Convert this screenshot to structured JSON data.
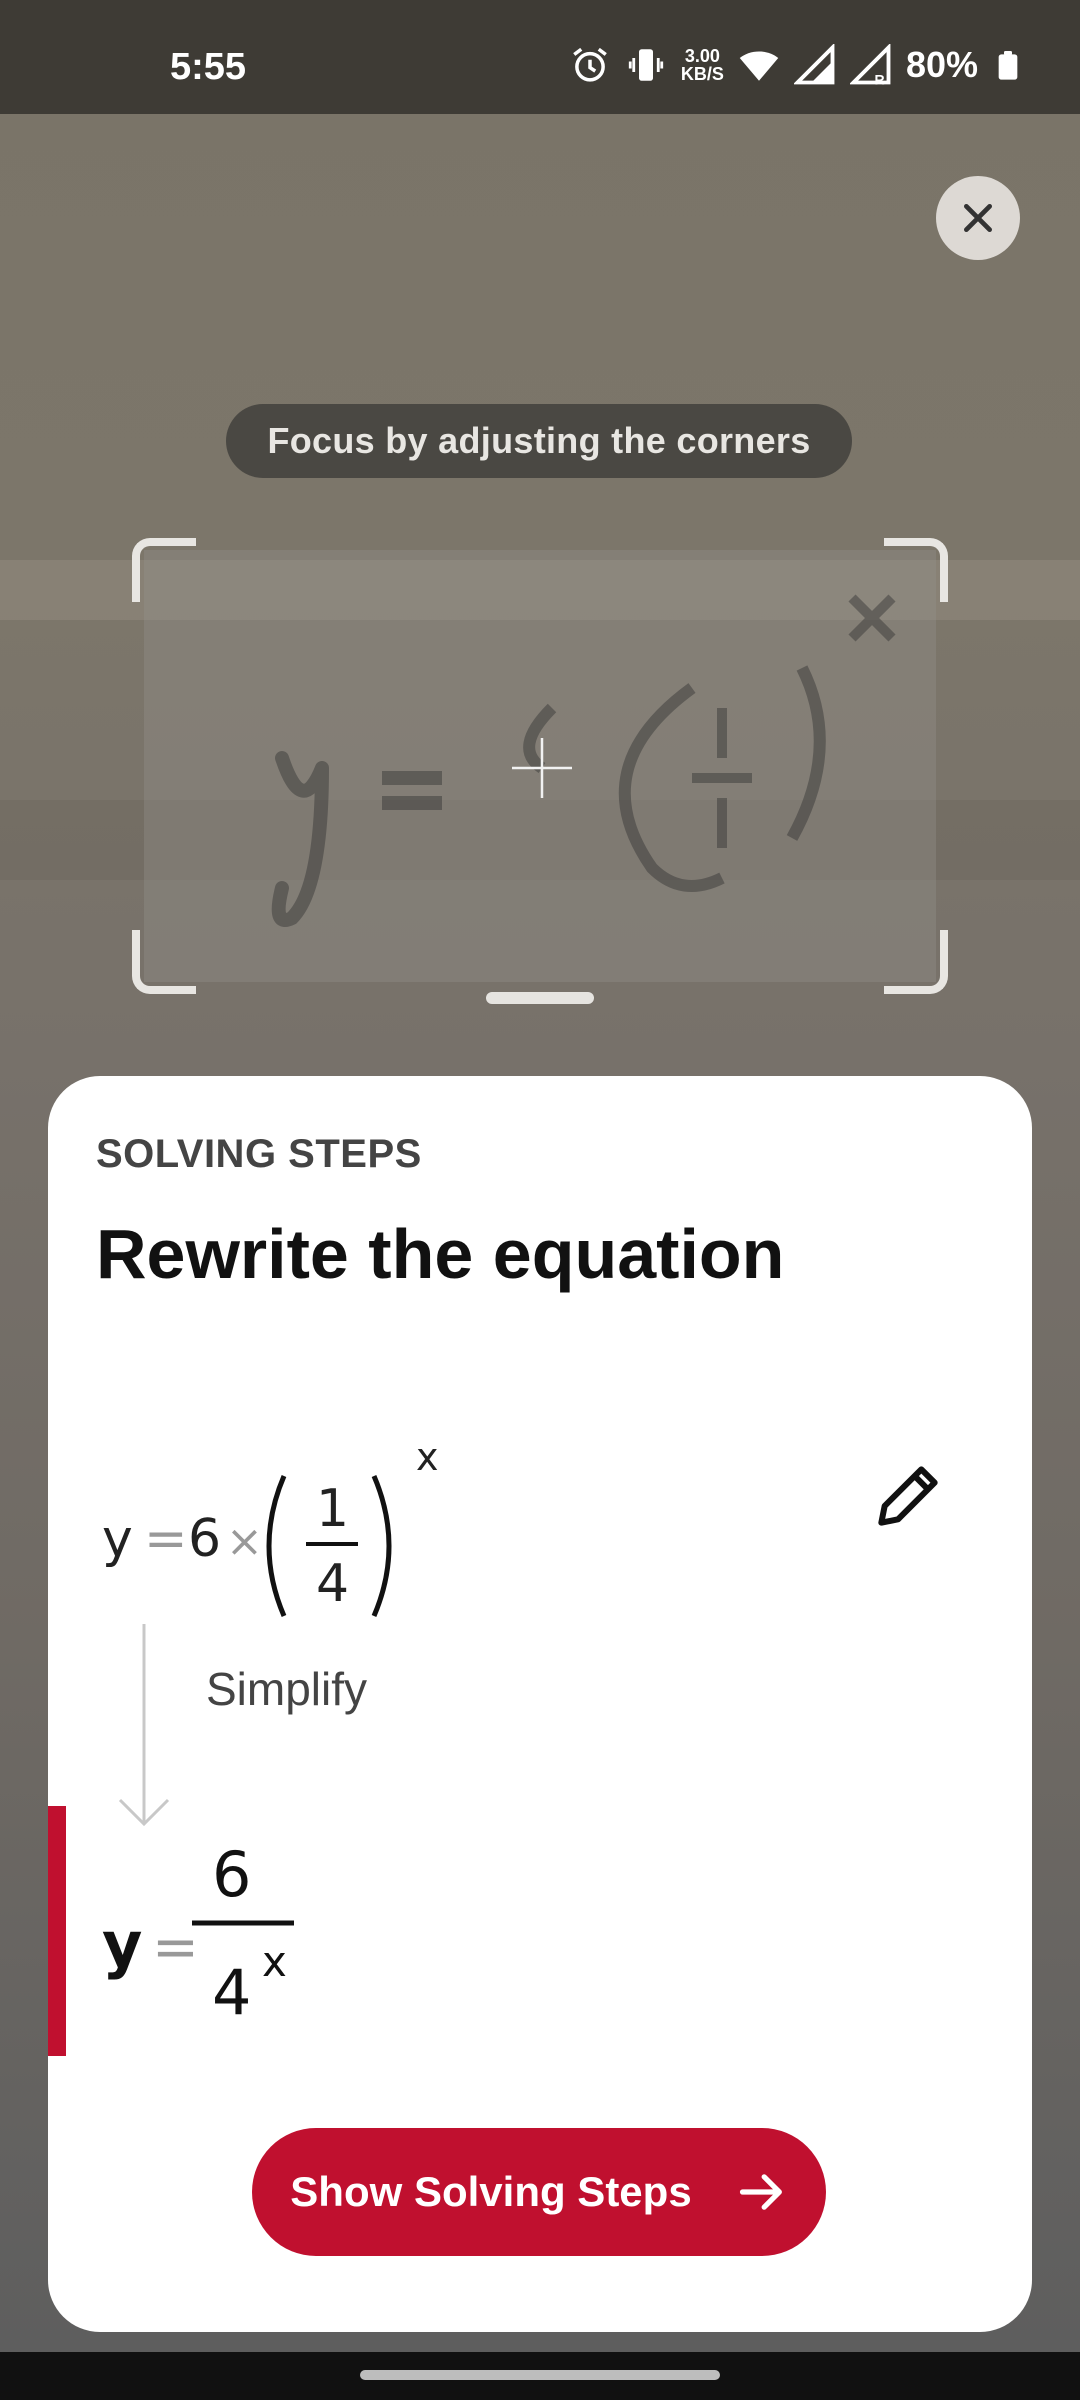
{
  "status_bar": {
    "time": "5:55",
    "speed_value": "3.00",
    "speed_unit": "KB/S",
    "battery": "80%",
    "icons": [
      "alarm-icon",
      "vibrate-icon",
      "wifi-icon",
      "signal-icon",
      "signal-roaming-icon",
      "battery-icon"
    ]
  },
  "camera": {
    "hint": "Focus by adjusting the corners"
  },
  "sheet": {
    "label": "SOLVING STEPS",
    "title": "Rewrite the equation",
    "step_label": "Simplify",
    "equation_original": {
      "lhs": "y",
      "eq": "=",
      "coef": "6",
      "times": "×",
      "frac_num": "1",
      "frac_den": "4",
      "exponent": "x"
    },
    "equation_result": {
      "lhs": "y",
      "eq": "=",
      "num": "6",
      "den_base": "4",
      "den_exp": "x"
    },
    "button_label": "Show Solving Steps"
  },
  "colors": {
    "accent": "#c0102f",
    "sheet_bg": "#ffffff",
    "status_bg": "#3e3b35"
  }
}
